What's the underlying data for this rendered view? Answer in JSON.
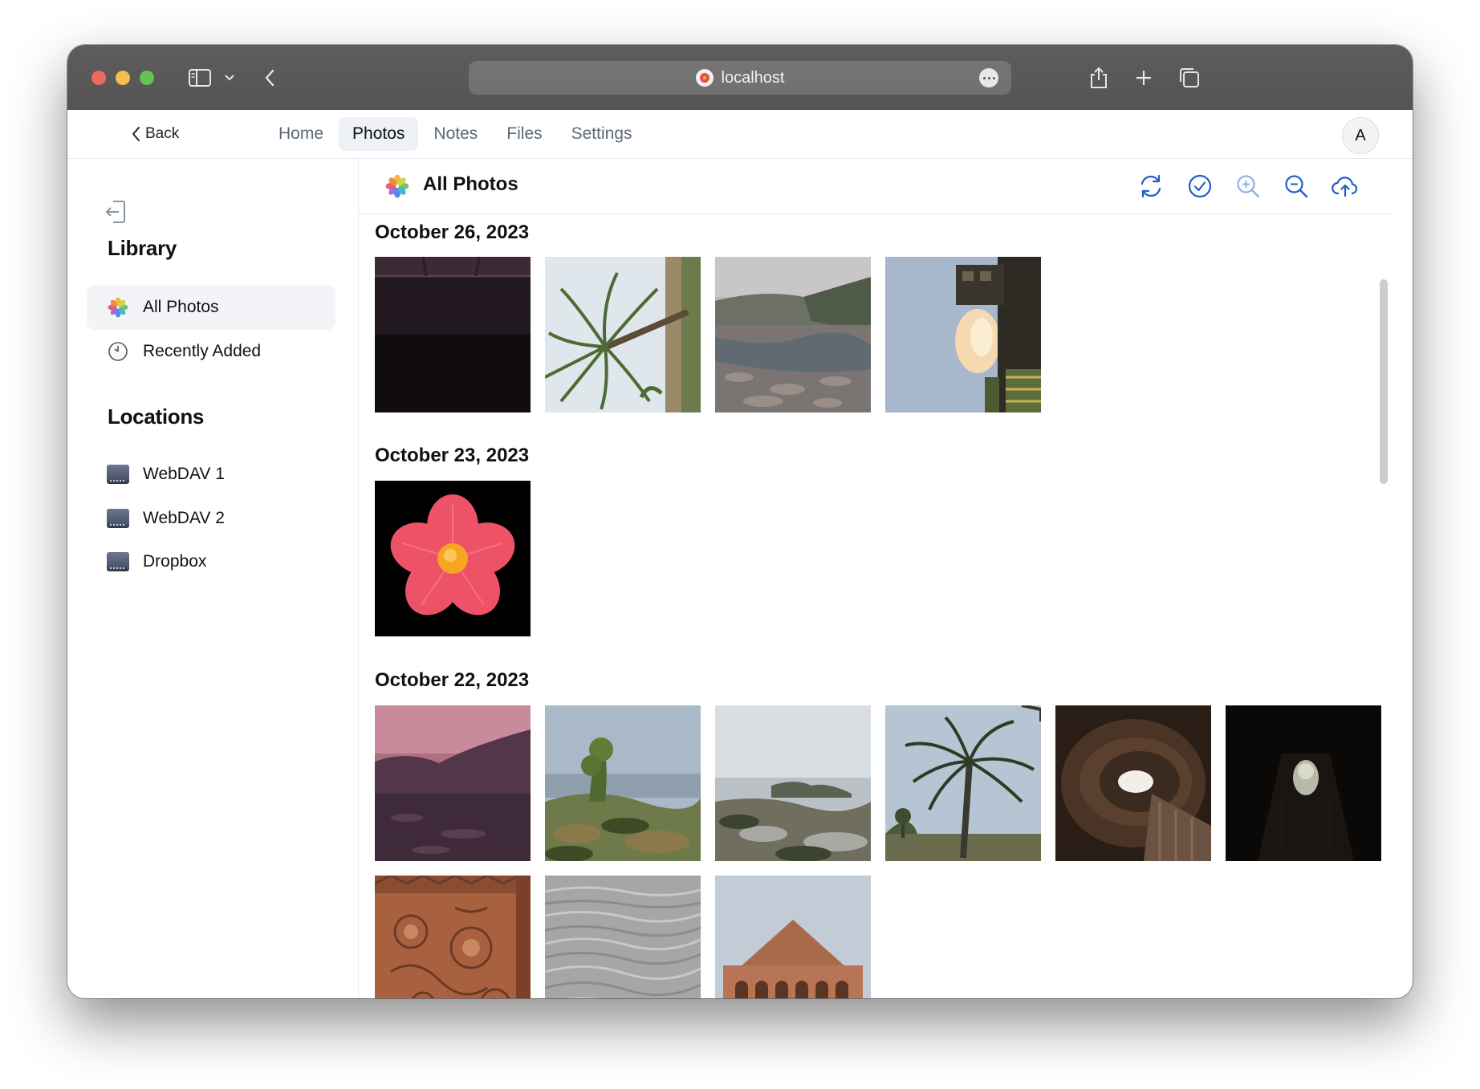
{
  "browser": {
    "url": "localhost",
    "icons": [
      "sidebar-toggle-icon",
      "chevron-down-icon",
      "back-arrow-icon",
      "more-icon",
      "share-icon",
      "plus-icon",
      "tabs-overview-icon"
    ]
  },
  "nav": {
    "back_label": "Back",
    "tabs": [
      {
        "label": "Home",
        "active": false
      },
      {
        "label": "Photos",
        "active": true
      },
      {
        "label": "Notes",
        "active": false
      },
      {
        "label": "Files",
        "active": false
      },
      {
        "label": "Settings",
        "active": false
      }
    ],
    "avatar_initial": "A"
  },
  "sidebar": {
    "library_heading": "Library",
    "library_items": [
      {
        "label": "All Photos",
        "icon": "photos-flower-icon",
        "active": true
      },
      {
        "label": "Recently Added",
        "icon": "clock-icon",
        "active": false
      }
    ],
    "locations_heading": "Locations",
    "location_items": [
      {
        "label": "WebDAV 1",
        "icon": "drive-icon"
      },
      {
        "label": "WebDAV 2",
        "icon": "drive-icon"
      },
      {
        "label": "Dropbox",
        "icon": "drive-icon"
      }
    ]
  },
  "main": {
    "title": "All Photos",
    "toolbar": [
      "refresh-icon",
      "select-check-icon",
      "zoom-in-icon",
      "zoom-out-icon",
      "upload-cloud-icon"
    ],
    "groups": [
      {
        "date": "October 26, 2023",
        "photos": [
          "dark-interior",
          "palm-tree-sideways",
          "rocky-river",
          "building-sky-sideways"
        ]
      },
      {
        "date": "October 23, 2023",
        "photos": [
          "pink-flower-icon"
        ]
      },
      {
        "date": "October 22, 2023",
        "photos": [
          "pink-dusk-landscape",
          "shrubs-lake",
          "hazy-lake-hill",
          "palm-tree",
          "brick-arch-tunnel",
          "dark-tunnel",
          "terracotta-carving",
          "water-surface",
          "terracotta-temple"
        ]
      }
    ]
  },
  "colors": {
    "accent": "#1f5fc7",
    "titlebar": "#5a5858",
    "active_tab_bg": "#eef1f5"
  }
}
